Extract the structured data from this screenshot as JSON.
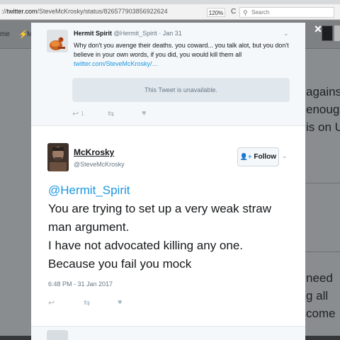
{
  "browser": {
    "url_prefix": "://",
    "url_domain": "twitter.com",
    "url_path": "/SteveMcKrosky/status/826577903856922624",
    "zoom": "120%",
    "search_placeholder": "Search",
    "reload_icon": "reload-icon",
    "search_icon": "search-icon"
  },
  "background": {
    "nav_home": "me",
    "nav_bolt": "⚡",
    "nav_m": "M",
    "text_lines": [
      "against",
      "enough",
      "is on U",
      "need",
      "g all",
      "come"
    ]
  },
  "modal": {
    "close_label": "×",
    "parent_tweet": {
      "name": "Hermit Spirit",
      "handle": "@Hermit_Spirit",
      "separator": " · ",
      "date": "Jan 31",
      "text": "Why don't you avenge their deaths. you coward... you talk alot, but you don't believe in your own words, if you did, you would kill them all ",
      "link": "twitter.com/SteveMcKrosky/…",
      "unavailable_text": "This Tweet is unavailable.",
      "reply_count": "1",
      "reply_icon": "reply-icon",
      "retweet_icon": "retweet-icon",
      "like_icon": "heart-icon"
    },
    "main_tweet": {
      "name": "McKrosky",
      "handle": "@SteveMcKrosky",
      "follow_label": "Follow",
      "mention": "@Hermit_Spirit",
      "lines": [
        "You are trying to set up a very weak straw man argument.",
        "I have not advocated killing any one.",
        "Because you fail you mock"
      ],
      "timestamp": "6:48 PM - 31 Jan 2017"
    }
  },
  "colors": {
    "link": "#1b95e0",
    "muted": "#657786",
    "action_icon": "#aab8c2",
    "overlay": "#8a8d90"
  }
}
